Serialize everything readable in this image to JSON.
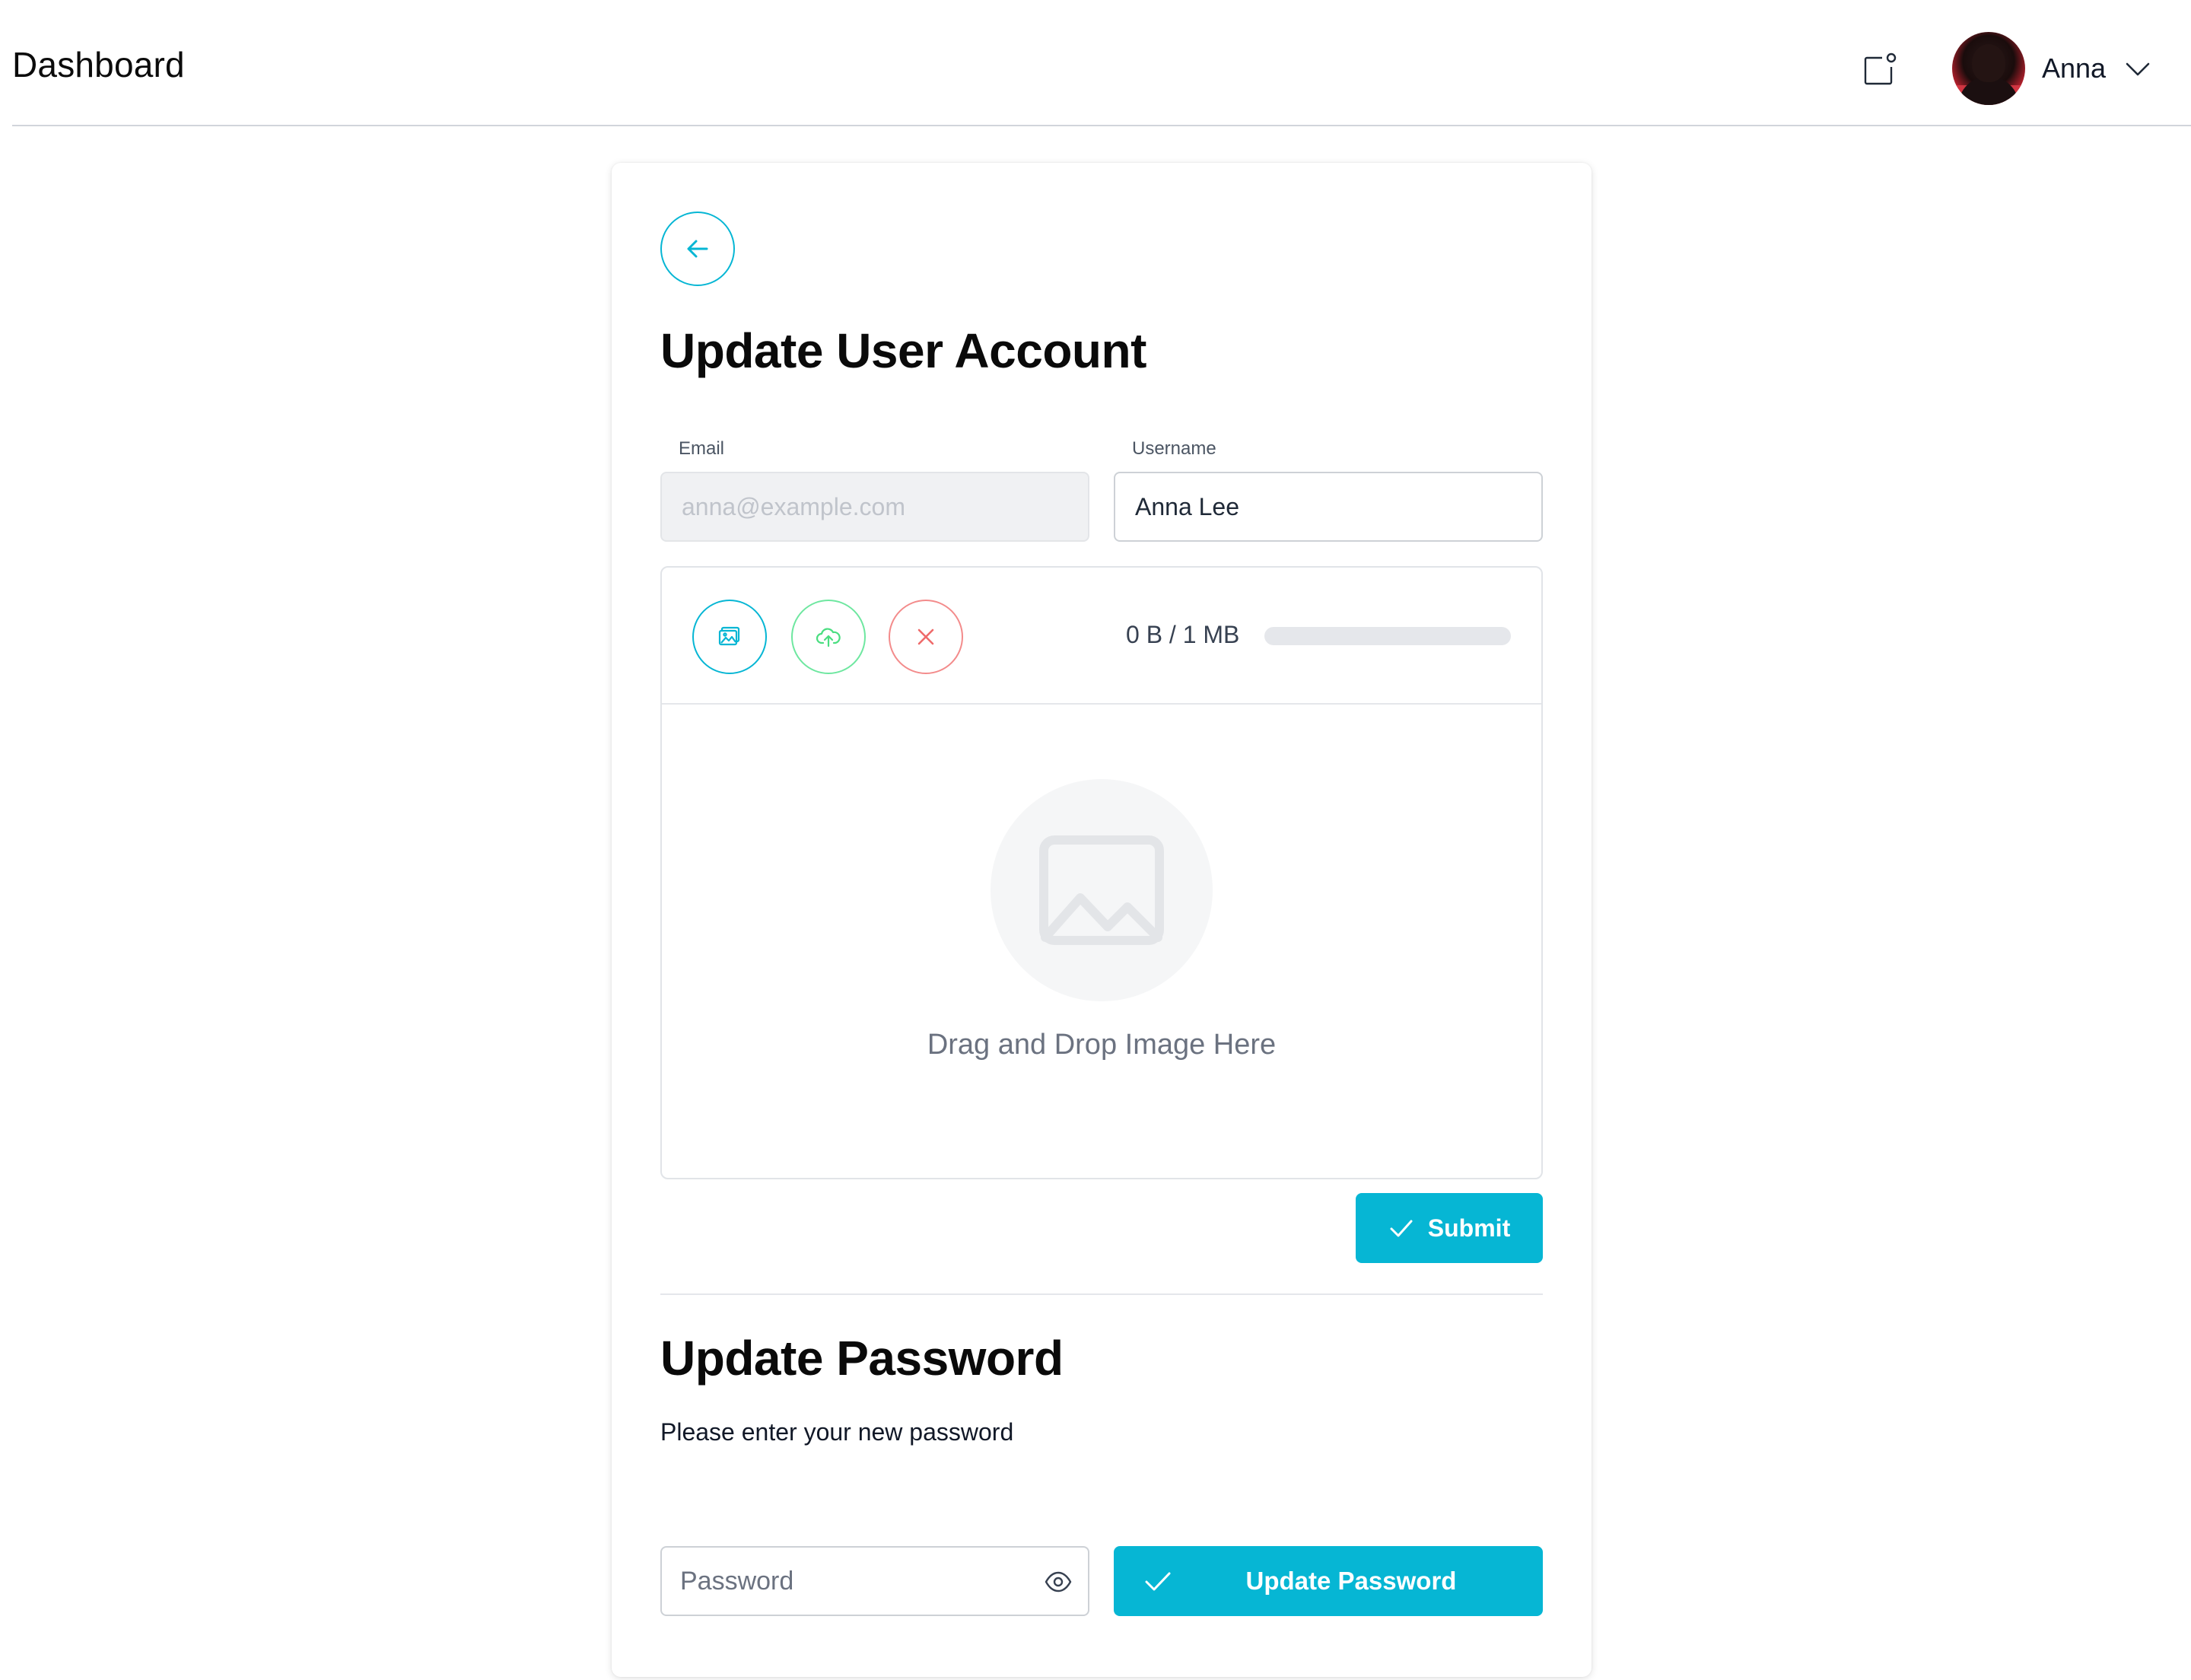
{
  "header": {
    "title": "Dashboard",
    "user_name": "Anna"
  },
  "card": {
    "title": "Update User Account",
    "email": {
      "label": "Email",
      "placeholder": "anna@example.com"
    },
    "username": {
      "label": "Username",
      "value": "Anna Lee"
    },
    "uploader": {
      "size_text": "0 B / 1 MB",
      "progress_fraction": 0,
      "drop_text": "Drag and Drop Image Here"
    },
    "submit_label": "Submit"
  },
  "password_section": {
    "title": "Update Password",
    "subtitle": "Please enter your new password",
    "password_placeholder": "Password",
    "button_label": "Update Password"
  },
  "colors": {
    "accent": "#06b6d4",
    "upload_green": "#6ee7a0",
    "remove_red": "#f38b8b"
  },
  "icons": {
    "notification": "notification-icon",
    "chevron": "chevron-down-icon",
    "back": "arrow-left-icon",
    "image": "image-icon",
    "upload": "cloud-upload-icon",
    "remove": "close-icon",
    "placeholder": "image-placeholder-icon",
    "check": "check-icon",
    "eye": "eye-icon"
  }
}
